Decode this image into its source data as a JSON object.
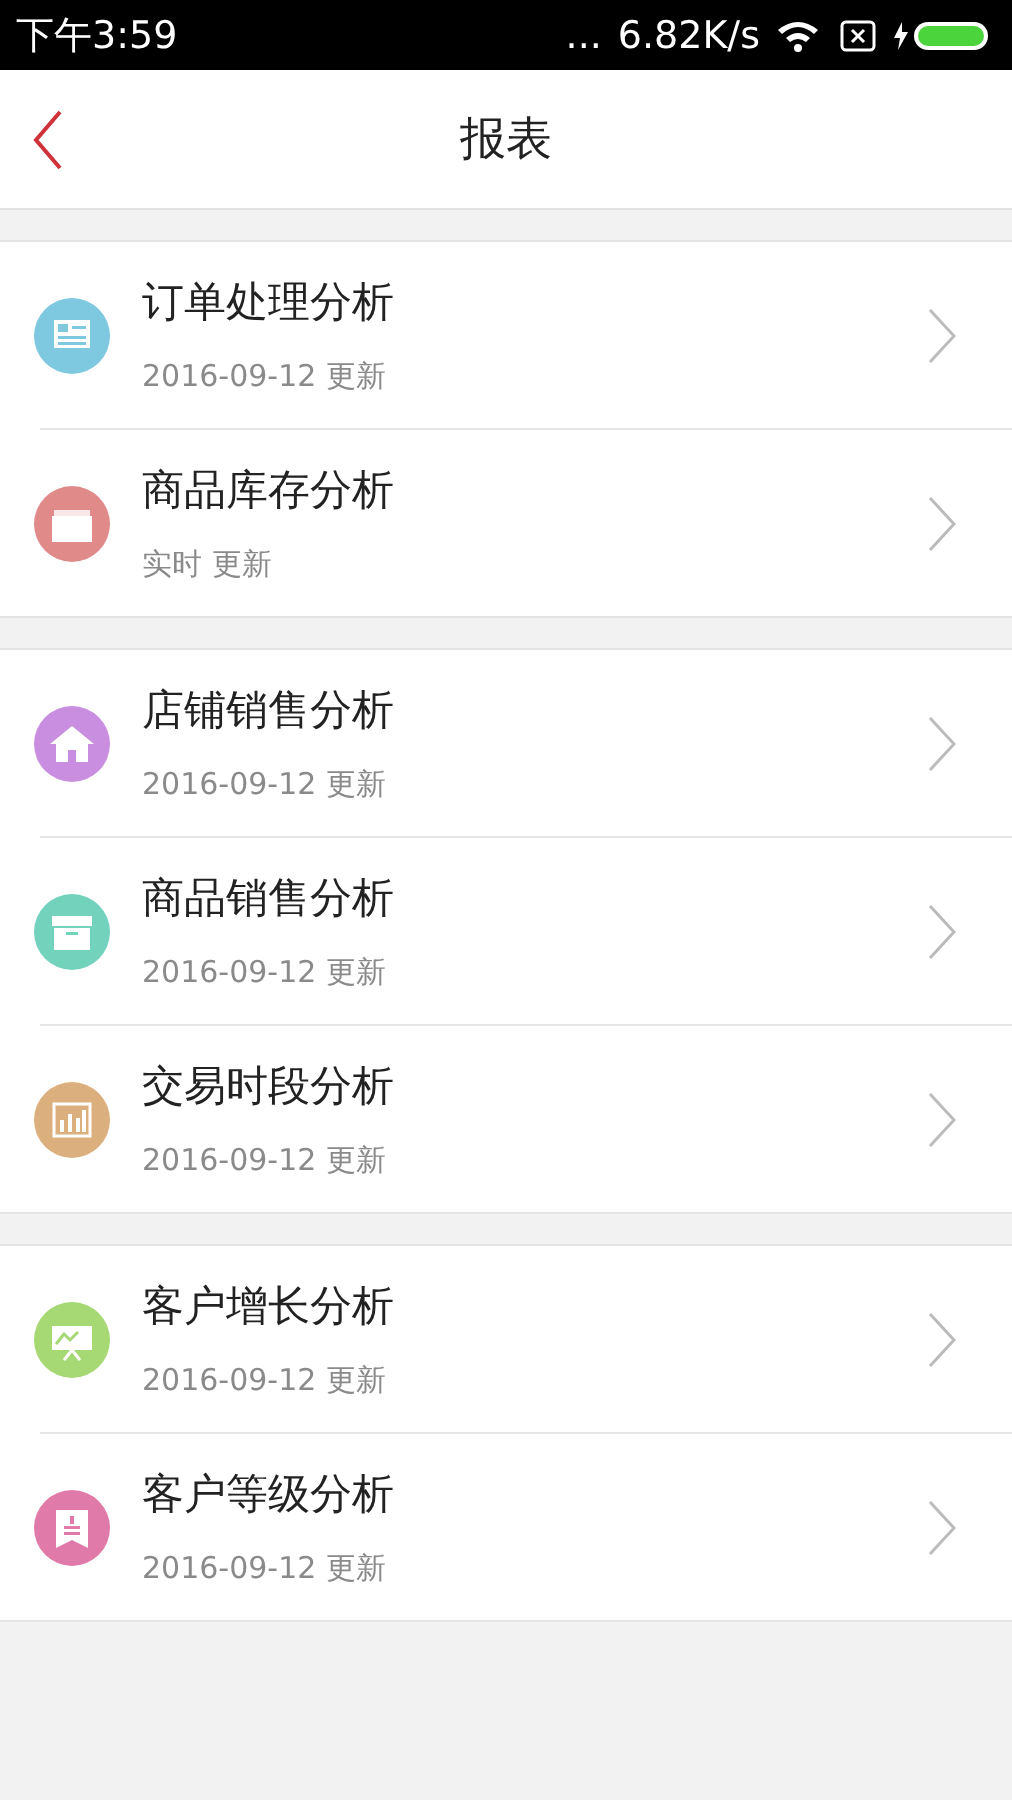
{
  "status_bar": {
    "time": "下午3:59",
    "dots": "...",
    "speed": "6.82K/s"
  },
  "header": {
    "title": "报表"
  },
  "groups": [
    {
      "items": [
        {
          "title": "订单处理分析",
          "subtitle": "2016-09-12 更新",
          "color": "#7ec8e0",
          "kind": "document"
        },
        {
          "title": "商品库存分析",
          "subtitle": "实时 更新",
          "color": "#e08a8a",
          "kind": "folder"
        }
      ]
    },
    {
      "items": [
        {
          "title": "店铺销售分析",
          "subtitle": "2016-09-12 更新",
          "color": "#c98ee0",
          "kind": "house"
        },
        {
          "title": "商品销售分析",
          "subtitle": "2016-09-12 更新",
          "color": "#72d2bc",
          "kind": "box"
        },
        {
          "title": "交易时段分析",
          "subtitle": "2016-09-12 更新",
          "color": "#dcb07e",
          "kind": "chart"
        }
      ]
    },
    {
      "items": [
        {
          "title": "客户增长分析",
          "subtitle": "2016-09-12 更新",
          "color": "#a6d874",
          "kind": "board"
        },
        {
          "title": "客户等级分析",
          "subtitle": "2016-09-12 更新",
          "color": "#e07aa8",
          "kind": "badge"
        }
      ]
    }
  ]
}
